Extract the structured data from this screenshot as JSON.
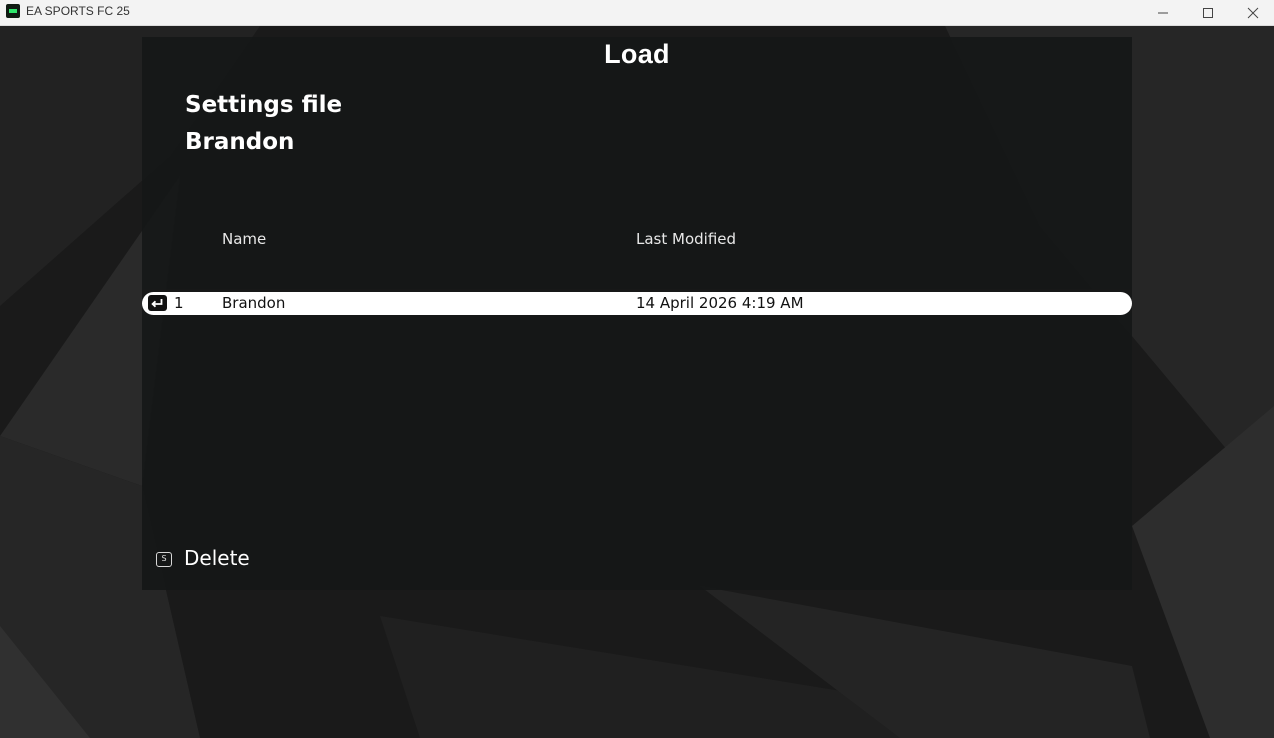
{
  "window": {
    "title": "EA SPORTS FC 25",
    "app_icon": "ea-sports-fc-icon",
    "controls": [
      "minimize-icon",
      "maximize-icon",
      "close-icon"
    ]
  },
  "screen": {
    "title": "Load",
    "settings_label": "Settings file",
    "settings_name": "Brandon"
  },
  "table": {
    "columns": [
      "Name",
      "Last Modified"
    ],
    "rows": [
      {
        "index": "1",
        "name": "Brandon",
        "last_modified": "14 April 2026 4:19 AM",
        "selected": true,
        "icon": "enter-key-icon"
      }
    ]
  },
  "actions": {
    "delete_key": "S",
    "delete_label": "Delete"
  },
  "colors": {
    "background": "#1b1b1b",
    "panel": "#161818",
    "selected_row": "#ffffff",
    "text": "#ffffff"
  }
}
